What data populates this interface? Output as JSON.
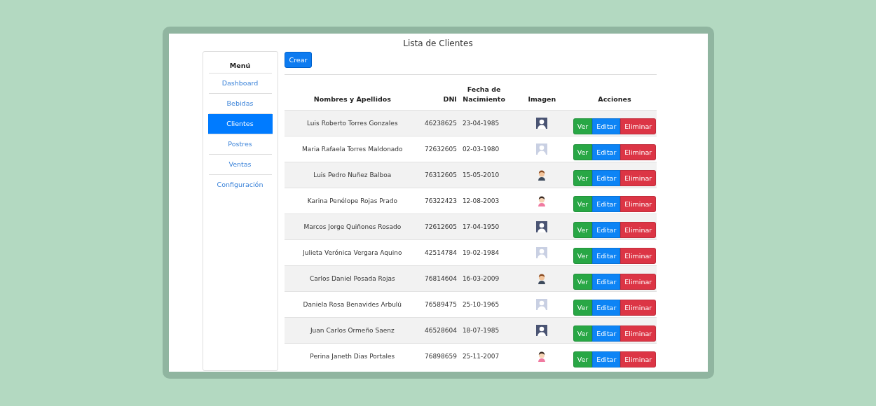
{
  "title": "Lista de Clientes",
  "sidebar": {
    "heading": "Menú",
    "items": [
      {
        "label": "Dashboard",
        "selected": false
      },
      {
        "label": "Bebidas",
        "selected": false
      },
      {
        "label": "Clientes",
        "selected": true
      },
      {
        "label": "Postres",
        "selected": false
      },
      {
        "label": "Ventas",
        "selected": false
      },
      {
        "label": "Configuración",
        "selected": false
      }
    ]
  },
  "create_button": "Crear",
  "table": {
    "columns": [
      "Nombres y Apellidos",
      "DNI",
      "Fecha de Nacimiento",
      "Imagen",
      "Acciones"
    ],
    "rows": [
      {
        "name": "Luis Roberto Torres Gonzales",
        "dni": "46238625",
        "birth": "23-04-1985",
        "kind": "dark",
        "actions": [
          "Ver",
          "Editar",
          "Eliminar"
        ]
      },
      {
        "name": "Maria Rafaela Torres Maldonado",
        "dni": "72632605",
        "birth": "02-03-1980",
        "kind": "light",
        "actions": [
          "Ver",
          "Editar",
          "Eliminar"
        ]
      },
      {
        "name": "Luis Pedro Nuñez Balboa",
        "dni": "76312605",
        "birth": "15-05-2010",
        "kind": "boy",
        "actions": [
          "Ver",
          "Editar",
          "Eliminar"
        ]
      },
      {
        "name": "Karina Penélope Rojas Prado",
        "dni": "76322423",
        "birth": "12-08-2003",
        "kind": "girl",
        "actions": [
          "Ver",
          "Editar",
          "Eliminar"
        ]
      },
      {
        "name": "Marcos Jorge Quiñones Rosado",
        "dni": "72612605",
        "birth": "17-04-1950",
        "kind": "dark",
        "actions": [
          "Ver",
          "Editar",
          "Eliminar"
        ]
      },
      {
        "name": "Julieta Verónica Vergara Aquino",
        "dni": "42514784",
        "birth": "19-02-1984",
        "kind": "light",
        "actions": [
          "Ver",
          "Editar",
          "Eliminar"
        ]
      },
      {
        "name": "Carlos Daniel Posada Rojas",
        "dni": "76814604",
        "birth": "16-03-2009",
        "kind": "boy",
        "actions": [
          "Ver",
          "Editar",
          "Eliminar"
        ]
      },
      {
        "name": "Daniela Rosa Benavides Arbulú",
        "dni": "76589475",
        "birth": "25-10-1965",
        "kind": "light",
        "actions": [
          "Ver",
          "Editar",
          "Eliminar"
        ]
      },
      {
        "name": "Juan Carlos Ormeño Saenz",
        "dni": "46528604",
        "birth": "18-07-1985",
        "kind": "dark",
        "actions": [
          "Ver",
          "Editar",
          "Eliminar"
        ]
      },
      {
        "name": "Perina Janeth Dias Portales",
        "dni": "76898659",
        "birth": "25-11-2007",
        "kind": "girl",
        "actions": [
          "Ver",
          "Editar",
          "Eliminar"
        ]
      }
    ]
  }
}
